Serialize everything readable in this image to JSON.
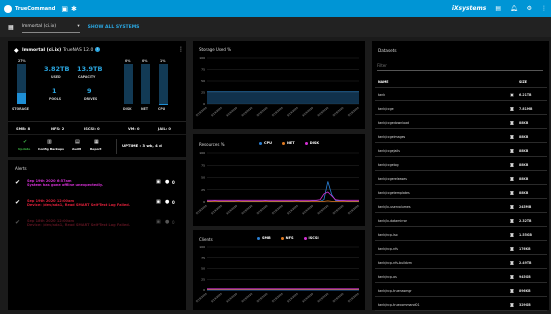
{
  "topbar": {
    "brand": "TrueCommand",
    "ix_label": "iXsystems",
    "bg_color": "#0095d5"
  },
  "subbar": {
    "system_select": "Immortal (ci.ix)",
    "show_all": "SHOW ALL SYSTEMS"
  },
  "system_card": {
    "name": "Immortal (ci.ix)",
    "version": "TrueNAS 12.0",
    "storage": {
      "percent_label": "27%",
      "fill": 0.27,
      "label": "STORAGE",
      "used": "3.82TB",
      "used_label": "USED",
      "capacity": "13.9TB",
      "capacity_label": "CAPACITY",
      "pools": "1",
      "pools_label": "POOLS",
      "drives": "9",
      "drives_label": "DRIVES"
    },
    "disk": {
      "percent_label": "0%",
      "fill": 0.0,
      "label": "DISK"
    },
    "net": {
      "percent_label": "0%",
      "fill": 0.0,
      "label": "NET"
    },
    "cpu": {
      "percent_label": "1%",
      "fill": 0.01,
      "label": "CPU"
    },
    "shares": [
      {
        "label": "SMB: 8"
      },
      {
        "label": "NFS: 2"
      },
      {
        "label": "iSCSI: 0"
      },
      {
        "label": "VM: 0"
      },
      {
        "label": "JAIL: 0"
      }
    ]
  },
  "actions_card": {
    "buttons": [
      {
        "label": "Update",
        "icon": "check-icon"
      },
      {
        "label": "Config Backups",
        "icon": "backup-icon"
      },
      {
        "label": "Audit",
        "icon": "audit-icon"
      },
      {
        "label": "Report",
        "icon": "report-icon"
      }
    ],
    "uptime": "UPTIME : 3 wk, 4 d"
  },
  "alerts": {
    "title": "Alerts",
    "items": [
      {
        "date": "Sep 19th 2020 6:57am",
        "text": "System has gone offline unexpectedly.",
        "color": "#d430d4",
        "count": "0"
      },
      {
        "date": "Sep 19th 2020 12:00am",
        "text": "Device: /dev/ada1, Read SMART Self-Test Log Failed.",
        "color": "#e0203a",
        "count": "0"
      },
      {
        "date": "Sep 18th 2020 12:00am",
        "text": "Device: /dev/ada1, Read SMART Self-Test Log Failed.",
        "color": "#5a1420",
        "count": "0"
      }
    ]
  },
  "storage_chart": {
    "title": "Storage Used %",
    "chart_data": {
      "type": "area",
      "title": "Storage Used %",
      "ylim": [
        0,
        100
      ],
      "yticks": [
        "100",
        "75",
        "50",
        "25",
        "0"
      ],
      "xticks": [
        "9/19/2020",
        "9/19/2020",
        "9/19/2020",
        "9/19/2020",
        "9/19/2020",
        "9/19/2020",
        "9/19/2020",
        "9/19/2020",
        "9/19/2020",
        "9/19/2020",
        "9/19/2020"
      ],
      "series": [
        {
          "values": [
            27,
            27,
            27,
            27,
            27,
            27,
            27,
            27,
            27,
            27,
            27
          ],
          "color": "#1e5a8a"
        }
      ]
    }
  },
  "resources_chart": {
    "title": "Resources %",
    "chart_data": {
      "type": "line",
      "title": "Resources %",
      "ylim": [
        0,
        100
      ],
      "yticks": [
        "100",
        "75",
        "50",
        "25",
        "0"
      ],
      "xticks": [
        "9/19/2020",
        "9/19/2020",
        "9/19/2020",
        "9/19/2020",
        "9/19/2020",
        "9/19/2020",
        "9/19/2020",
        "9/19/2020",
        "9/19/2020",
        "9/19/2020",
        "9/19/2020"
      ],
      "series": [
        {
          "name": "CPU",
          "color": "#2a7fd4",
          "values": [
            1,
            1,
            2,
            1,
            1,
            1,
            1,
            1,
            2,
            1,
            1,
            1,
            1,
            1,
            1,
            2,
            1,
            1,
            1,
            1,
            1,
            1,
            1,
            2,
            1,
            1,
            1,
            2,
            2,
            1,
            5,
            42,
            15,
            3,
            2,
            2,
            1,
            1,
            1,
            1
          ]
        },
        {
          "name": "NET",
          "color": "#e07a20",
          "values": [
            0,
            0,
            0,
            0,
            0,
            0,
            0,
            0,
            0,
            0,
            0,
            0,
            0,
            0,
            0,
            0,
            0,
            0,
            0,
            0,
            0,
            0,
            0,
            0,
            0,
            0,
            0,
            0,
            0,
            0,
            0,
            1,
            0,
            0,
            0,
            0,
            0,
            0,
            0,
            0
          ]
        },
        {
          "name": "DISK",
          "color": "#d430d4",
          "values": [
            1,
            1,
            1,
            1,
            1,
            1,
            1,
            1,
            1,
            1,
            1,
            1,
            1,
            1,
            1,
            1,
            1,
            1,
            1,
            1,
            1,
            1,
            1,
            1,
            1,
            1,
            1,
            1,
            1,
            2,
            14,
            18,
            10,
            2,
            1,
            1,
            1,
            1,
            1,
            1
          ]
        }
      ]
    }
  },
  "clients_chart": {
    "title": "Clients",
    "chart_data": {
      "type": "line",
      "title": "Clients",
      "ylim": [
        0,
        100
      ],
      "yticks": [
        "100",
        "75",
        "50",
        "25",
        "0"
      ],
      "xticks": [
        "9/19/2020",
        "9/19/2020",
        "9/19/2020",
        "9/19/2020",
        "9/19/2020",
        "9/19/2020",
        "9/19/2020",
        "9/19/2020",
        "9/19/2020",
        "9/19/2020",
        "9/19/2020"
      ],
      "series": [
        {
          "name": "SMB",
          "color": "#2a7fd4",
          "values": [
            0,
            0,
            0,
            0,
            0,
            0,
            0,
            0,
            0,
            0,
            0
          ]
        },
        {
          "name": "NFS",
          "color": "#e07a20",
          "values": [
            0,
            0,
            0,
            0,
            0,
            0,
            0,
            0,
            0,
            0,
            0
          ]
        },
        {
          "name": "iSCSI",
          "color": "#d430d4",
          "values": [
            0,
            0,
            0,
            0,
            0,
            0,
            0,
            0,
            0,
            0,
            0
          ]
        }
      ]
    }
  },
  "datasets": {
    "title": "Datasets",
    "filter_placeholder": "Filter",
    "col_name": "NAME",
    "col_size": "SIZE",
    "rows": [
      {
        "name": "tank",
        "icon": "calendar-icon",
        "size": "6.21TB"
      },
      {
        "name": "tank/ccge",
        "icon": "camera-icon",
        "size": "7.81MB"
      },
      {
        "name": "tank/ccgedownload",
        "icon": "camera-icon",
        "size": "88KB"
      },
      {
        "name": "tank/ccgeimages",
        "icon": "camera-icon",
        "size": "88KB"
      },
      {
        "name": "tank/ccgejails",
        "icon": "camera-icon",
        "size": "88KB"
      },
      {
        "name": "tank/ccgelog",
        "icon": "camera-icon",
        "size": "88KB"
      },
      {
        "name": "tank/ccgereleases",
        "icon": "camera-icon",
        "size": "88KB"
      },
      {
        "name": "tank/ccgetemplates",
        "icon": "camera-icon",
        "size": "88KB"
      },
      {
        "name": "tank/ix-uservolumes",
        "icon": "camera-icon",
        "size": "245MB"
      },
      {
        "name": "tank/ix-datamirror",
        "icon": "camera-icon",
        "size": "2.32TB"
      },
      {
        "name": "tank/ncp-iso",
        "icon": "camera-icon",
        "size": "1.55GB"
      },
      {
        "name": "tank/ncp-nfs",
        "icon": "camera-icon",
        "size": "176KB"
      },
      {
        "name": "tank/ncp-nfs-buildvm",
        "icon": "camera-icon",
        "size": "2.49TB"
      },
      {
        "name": "tank/ncp-os",
        "icon": "camera-icon",
        "size": "945GB"
      },
      {
        "name": "tank/ncp-truenasmgr",
        "icon": "camera-icon",
        "size": "896KB"
      },
      {
        "name": "tank/ncp-truecommand01",
        "icon": "camera-icon",
        "size": "329GB"
      }
    ]
  }
}
